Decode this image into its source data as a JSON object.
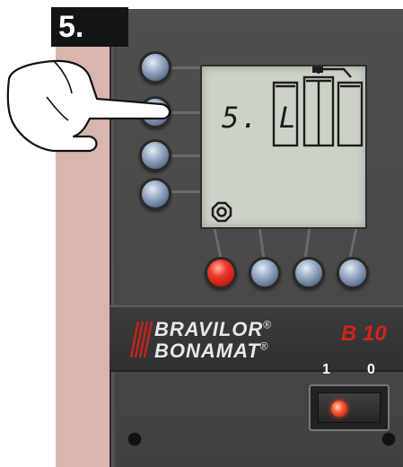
{
  "step": {
    "label": "5."
  },
  "display": {
    "text": "5. L",
    "icon": "gear-icon"
  },
  "brand": {
    "line1": "BRAVILOR",
    "line2": "BONAMAT",
    "reg": "®",
    "model": "B 10",
    "model_color": "#d0231b"
  },
  "switch": {
    "label_on": "1",
    "label_off": "0"
  },
  "colors": {
    "panel": "#4a4a4a",
    "lcd": "#cdd2c6",
    "wall": "#d8b6ad",
    "button": "#8fa3c0",
    "button_red": "#e0281c"
  }
}
